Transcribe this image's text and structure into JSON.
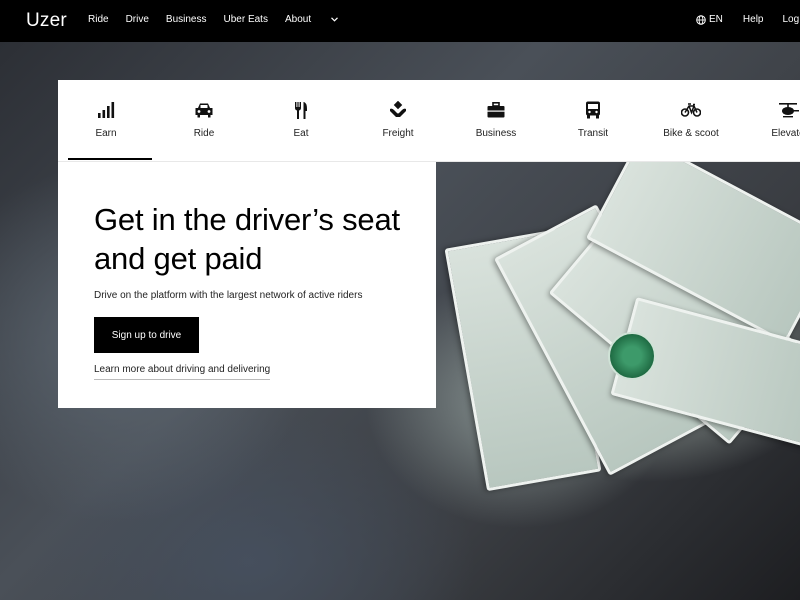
{
  "nav": {
    "brand": "Uzer",
    "links": [
      "Ride",
      "Drive",
      "Business",
      "Uber Eats"
    ],
    "about": "About",
    "language": "EN",
    "help": "Help",
    "login": "Log"
  },
  "tabs": [
    {
      "label": "Earn",
      "icon": "signal-bars-icon"
    },
    {
      "label": "Ride",
      "icon": "car-icon"
    },
    {
      "label": "Eat",
      "icon": "utensils-icon"
    },
    {
      "label": "Freight",
      "icon": "hand-box-icon"
    },
    {
      "label": "Business",
      "icon": "briefcase-icon"
    },
    {
      "label": "Transit",
      "icon": "bus-icon"
    },
    {
      "label": "Bike & scoot",
      "icon": "bike-icon"
    },
    {
      "label": "Elevate",
      "icon": "helicopter-icon"
    }
  ],
  "active_tab": "Earn",
  "hero": {
    "headline": "Get in the driver’s seat and get paid",
    "subtext": "Drive on the platform with the largest network of active riders",
    "cta": "Sign up to drive",
    "learn_link": "Learn more about driving and delivering"
  },
  "colors": {
    "nav_bg": "#000000",
    "cta_bg": "#000000",
    "card_bg": "#ffffff"
  }
}
